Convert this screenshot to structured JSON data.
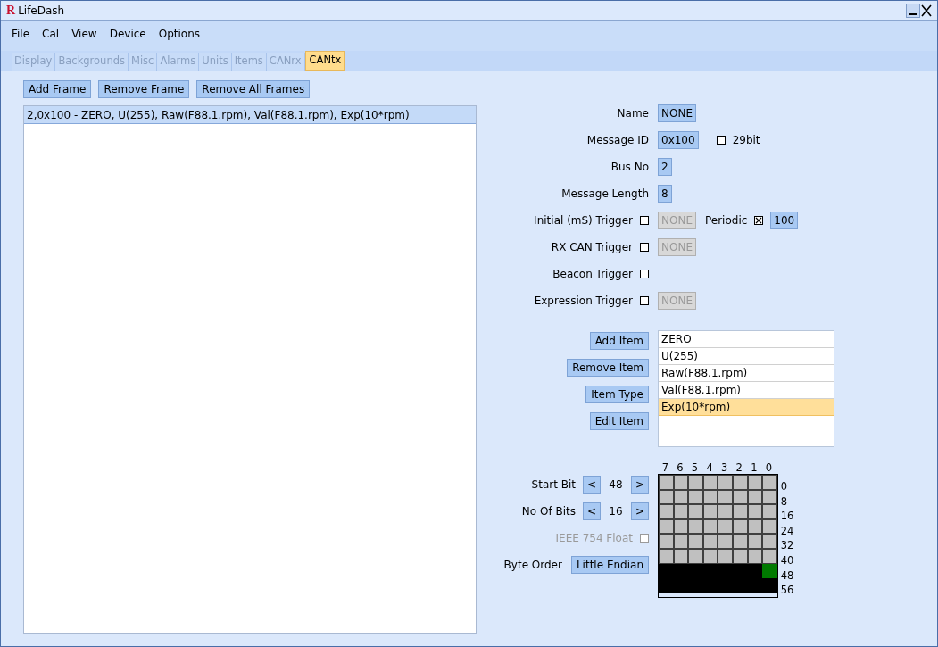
{
  "window": {
    "logo": "R",
    "title": "LifeDash"
  },
  "menu": [
    {
      "label": "File"
    },
    {
      "label": "Cal"
    },
    {
      "label": "View"
    },
    {
      "label": "Device"
    },
    {
      "label": "Options"
    }
  ],
  "tabs": [
    {
      "label": "Display",
      "selected": false
    },
    {
      "label": "Backgrounds",
      "selected": false
    },
    {
      "label": "Misc",
      "selected": false
    },
    {
      "label": "Alarms",
      "selected": false
    },
    {
      "label": "Units",
      "selected": false
    },
    {
      "label": "Items",
      "selected": false
    },
    {
      "label": "CANrx",
      "selected": false
    },
    {
      "label": "CANtx",
      "selected": true
    }
  ],
  "frame_buttons": [
    "Add Frame",
    "Remove Frame",
    "Remove All Frames"
  ],
  "frames": [
    {
      "label": "2,0x100 - ZERO, U(255), Raw(F88.1.rpm), Val(F88.1.rpm), Exp(10*rpm)",
      "selected": true
    }
  ],
  "fields": [
    {
      "kind": "value",
      "label": "Name",
      "value": {
        "text": "NONE",
        "disabled": false
      }
    },
    {
      "kind": "value",
      "label": "Message ID",
      "value": {
        "text": "0x100",
        "disabled": false
      },
      "option": {
        "label": "29bit",
        "checked": false
      }
    },
    {
      "kind": "value",
      "label": "Bus No",
      "value": {
        "text": "2",
        "disabled": false
      }
    },
    {
      "kind": "value",
      "label": "Message Length",
      "value": {
        "text": "8",
        "disabled": false
      }
    },
    {
      "kind": "trigger",
      "label": "Initial (mS) Trigger",
      "checked": false,
      "value": {
        "text": "NONE",
        "disabled": true
      },
      "extra": {
        "label": "Periodic",
        "checked": true,
        "value": {
          "text": "100",
          "disabled": false
        }
      }
    },
    {
      "kind": "trigger",
      "label": "RX CAN Trigger",
      "checked": false,
      "value": {
        "text": "NONE",
        "disabled": true
      }
    },
    {
      "kind": "trigger",
      "label": "Beacon Trigger",
      "checked": false
    },
    {
      "kind": "trigger",
      "label": "Expression Trigger",
      "checked": false,
      "value": {
        "text": "NONE",
        "disabled": true
      }
    }
  ],
  "item_buttons": [
    "Add Item",
    "Remove Item",
    "Item Type",
    "Edit Item"
  ],
  "items": [
    {
      "label": "ZERO",
      "selected": false
    },
    {
      "label": "U(255)",
      "selected": false
    },
    {
      "label": "Raw(F88.1.rpm)",
      "selected": false
    },
    {
      "label": "Val(F88.1.rpm)",
      "selected": false
    },
    {
      "label": "Exp(10*rpm)",
      "selected": true
    }
  ],
  "bit_settings": [
    {
      "kind": "stepper",
      "label": "Start Bit",
      "decrease": "<",
      "value": "48",
      "increase": ">"
    },
    {
      "kind": "stepper",
      "label": "No Of Bits",
      "decrease": "<",
      "value": "16",
      "increase": ">"
    },
    {
      "kind": "checkbox",
      "label": "IEEE 754 Float",
      "checked": false,
      "disabled": true
    },
    {
      "kind": "button",
      "label": "Byte Order",
      "value": "Little Endian"
    }
  ],
  "bit_grid": {
    "column_labels": [
      "7",
      "6",
      "5",
      "4",
      "3",
      "2",
      "1",
      "0"
    ],
    "rows": [
      {
        "label": "0",
        "used": false
      },
      {
        "label": "8",
        "used": false
      },
      {
        "label": "16",
        "used": false
      },
      {
        "label": "24",
        "used": false
      },
      {
        "label": "32",
        "used": false
      },
      {
        "label": "40",
        "used": false
      },
      {
        "label": "48",
        "used": true,
        "start_bit": true
      },
      {
        "label": "56",
        "used": true
      }
    ]
  }
}
